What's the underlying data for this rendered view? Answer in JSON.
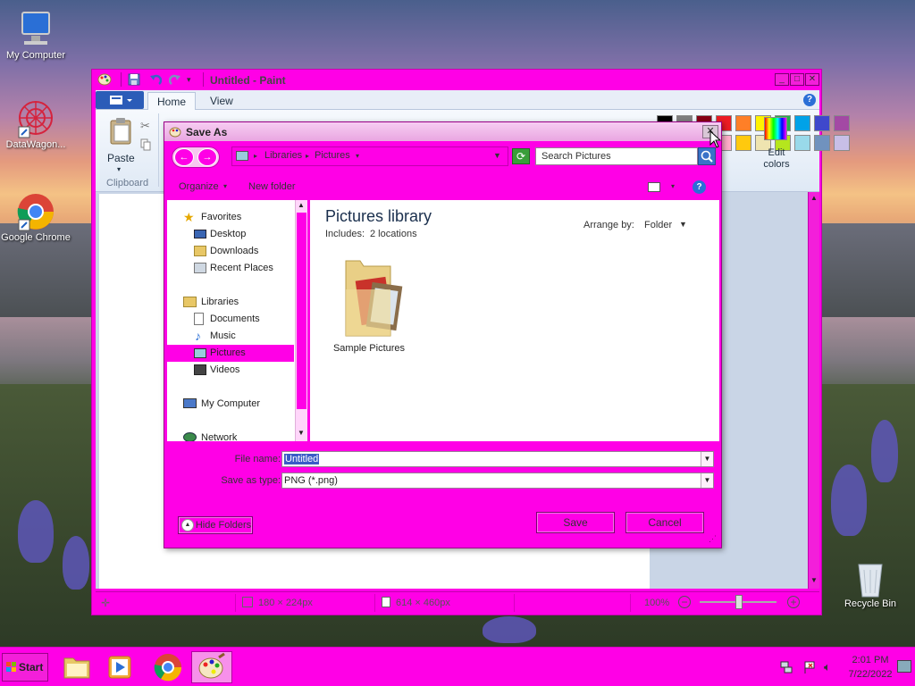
{
  "desktop": {
    "icons": [
      {
        "label": "My Computer"
      },
      {
        "label": "DataWagon..."
      },
      {
        "label": "Google Chrome"
      },
      {
        "label": "Recycle Bin"
      }
    ]
  },
  "paint": {
    "title": "Untitled - Paint",
    "tabs": [
      "Home",
      "View"
    ],
    "clipboard": {
      "paste_label": "Paste",
      "group_label": "Clipboard"
    },
    "edit_colors_label": "Edit colors",
    "palette": [
      "#000000",
      "#7f7f7f",
      "#880015",
      "#ed1c24",
      "#ff7f27",
      "#fff200",
      "#22b14c",
      "#00a2e8",
      "#3f48cc",
      "#a349a4",
      "#ffffff",
      "#c3c3c3",
      "#b97a57",
      "#ffaec9",
      "#ffc90e",
      "#efe4b0",
      "#b5e61d",
      "#99d9ea",
      "#7092be",
      "#c8bfe7"
    ],
    "status": {
      "cursor_pos": "180 × 224px",
      "canvas_size": "614 × 460px",
      "zoom": "100%"
    }
  },
  "dialog": {
    "title": "Save As",
    "breadcrumb": [
      "Libraries",
      "Pictures"
    ],
    "search_placeholder": "Search Pictures",
    "toolbar": {
      "organize": "Organize",
      "new_folder": "New folder"
    },
    "nav": {
      "favorites": "Favorites",
      "desktop": "Desktop",
      "downloads": "Downloads",
      "recent": "Recent Places",
      "libraries": "Libraries",
      "documents": "Documents",
      "music": "Music",
      "pictures": "Pictures",
      "videos": "Videos",
      "computer": "My Computer",
      "network": "Network"
    },
    "library_title": "Pictures library",
    "library_includes": "Includes:",
    "library_locations": "2 locations",
    "arrange_by_label": "Arrange by:",
    "arrange_by_value": "Folder",
    "folder_item": "Sample Pictures",
    "file_name_label": "File name:",
    "file_name_value": "Untitled",
    "save_type_label": "Save as type:",
    "save_type_value": "PNG (*.png)",
    "hide_folders": "Hide Folders",
    "save_button": "Save",
    "cancel_button": "Cancel"
  },
  "taskbar": {
    "start": "Start",
    "time": "2:01 PM",
    "date": "7/22/2022"
  },
  "colors": {
    "chrome": "#ff00e6",
    "selection": "#3a5cc7"
  }
}
